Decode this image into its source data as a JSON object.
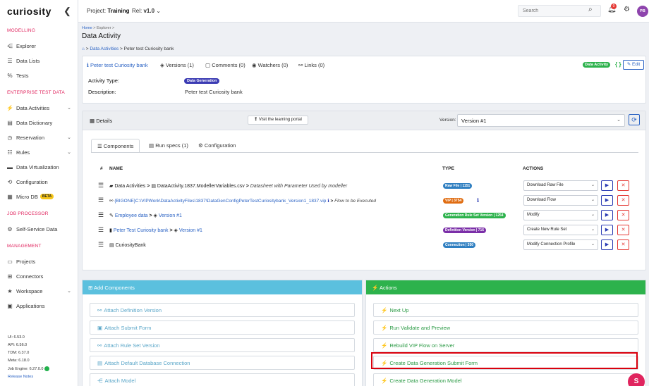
{
  "sidebar": {
    "logo": "curiosity",
    "collapse": "❮",
    "sections": [
      {
        "title": "MODELLING",
        "items": [
          {
            "label": "Explorer",
            "icon": "share-icon",
            "glyph": "⋲"
          },
          {
            "label": "Data Lists",
            "icon": "list-icon",
            "glyph": "☰"
          },
          {
            "label": "Tests",
            "icon": "percent-icon",
            "glyph": "%"
          }
        ]
      },
      {
        "title": "ENTERPRISE TEST DATA",
        "items": [
          {
            "label": "Data Activities",
            "icon": "bolt-icon",
            "glyph": "⚡",
            "chevron": "⌄"
          },
          {
            "label": "Data Dictionary",
            "icon": "book-icon",
            "glyph": "▤"
          },
          {
            "label": "Reservation",
            "icon": "clock-icon",
            "glyph": "◷",
            "chevron": "⌄"
          },
          {
            "label": "Rules",
            "icon": "rules-icon",
            "glyph": "☷",
            "chevron": "⌄"
          },
          {
            "label": "Data Virtualization",
            "icon": "virtualization-icon",
            "glyph": "▬"
          },
          {
            "label": "Configuration",
            "icon": "configuration-icon",
            "glyph": "⟲"
          },
          {
            "label": "Micro DB",
            "icon": "database-icon",
            "glyph": "▦",
            "badge": "BETA"
          }
        ]
      },
      {
        "title": "JOB PROCESSOR",
        "items": [
          {
            "label": "Self-Service Data",
            "icon": "gear-icon",
            "glyph": "⚙"
          }
        ]
      },
      {
        "title": "MANAGEMENT",
        "items": [
          {
            "label": "Projects",
            "icon": "folder-icon",
            "glyph": "▭"
          },
          {
            "label": "Connectors",
            "icon": "connectors-icon",
            "glyph": "⊞"
          },
          {
            "label": "Workspace",
            "icon": "star-icon",
            "glyph": "★",
            "chevron": "⌄"
          },
          {
            "label": "Applications",
            "icon": "applications-icon",
            "glyph": "▣"
          }
        ]
      }
    ],
    "versions": [
      "UI: 6.53.0",
      "API: 6.56.0",
      "TDM: 6.37.0",
      "Meta: 6.18.0",
      "Job Engine: 6.27.0.0"
    ],
    "release_notes": "Release Notes"
  },
  "topbar": {
    "project_label": "Project:",
    "project_value": "Training",
    "rel_label": "Rel:",
    "rel_value": "v1.0",
    "rel_chevron": "⌄",
    "search_placeholder": "Search",
    "notification_count": "0",
    "avatar_initials": "PB"
  },
  "breadcrumb": {
    "home": "Home",
    "sep": ">",
    "explorer": "Explorer",
    "page_title": "Data Activity",
    "trail_link": "Data Activities",
    "trail_current": "Peter test Curiosity bank"
  },
  "header": {
    "tabs": [
      {
        "label": "Peter test Curiosity bank",
        "icon": "info-icon",
        "glyph": "ℹ"
      },
      {
        "label": "Versions (1)",
        "icon": "layers-icon",
        "glyph": "◈"
      },
      {
        "label": "Comments (0)",
        "icon": "comment-icon",
        "glyph": "▢"
      },
      {
        "label": "Watchers (0)",
        "icon": "eye-icon",
        "glyph": "◉"
      },
      {
        "label": "Links (0)",
        "icon": "link-icon",
        "glyph": "⚯"
      }
    ],
    "status_badge": "Data Activity",
    "code_glyph": "{ }",
    "edit_label": "Edit",
    "activity_type_label": "Activity Type:",
    "activity_type_value": "Data Generation",
    "description_label": "Description:",
    "description_value": "Peter test Curiosity bank"
  },
  "details": {
    "title": "Details",
    "learning_portal": "Visit the learning portal",
    "version_label": "Version:",
    "version_value": "Version #1",
    "tabs": [
      {
        "label": "Components",
        "icon": "list-icon",
        "glyph": "☰"
      },
      {
        "label": "Run specs (1)",
        "icon": "runspecs-icon",
        "glyph": "▤"
      },
      {
        "label": "Configuration",
        "icon": "gear-icon",
        "glyph": "⚙"
      }
    ],
    "columns": {
      "hash": "#",
      "name": "NAME",
      "type": "TYPE",
      "actions": "ACTIONS"
    },
    "rows": [
      {
        "prefix": "Data Activities",
        "prefix_icon": "▰",
        "sep": ">",
        "file_icon": "▤",
        "link": "DataActivity.1837.ModellerVariables.csv",
        "suffix": "Datasheet with Parameter Used by modeller",
        "type": "Raw File | 1151",
        "type_color": "#2f7fc1",
        "action": "Download Raw File"
      },
      {
        "prefix": "",
        "prefix_icon": "⚯",
        "sep": "",
        "file_icon": "",
        "link": "{BIGONE}C:\\VIPWork\\DataActivityFiles\\1837\\DataGenConfigPeterTestCuriositybank_Version1_1837.vip",
        "suffix": "Flow to be Executed",
        "type": "VIP | 3754",
        "type_color": "#e06d12",
        "action": "Download Flow"
      },
      {
        "prefix": "",
        "prefix_icon": "✎",
        "sep": ">",
        "file_icon": "◈",
        "link": "Employee data",
        "link2": "Version #1",
        "suffix": "",
        "type": "Generation Rule Set Version | 1254",
        "type_color": "#2db24c",
        "action": "Modify"
      },
      {
        "prefix": "",
        "prefix_icon": "▮",
        "sep": ">",
        "file_icon": "◈",
        "link": "Peter Test Curiosity bank",
        "link2": "Version #1",
        "suffix": "",
        "type": "Definition Version | 716",
        "type_color": "#7b2fa8",
        "action": "Create New Rule Set"
      },
      {
        "prefix": "",
        "prefix_icon": "▤",
        "sep": "",
        "file_icon": "",
        "plain": "CuriosityBank",
        "suffix": "",
        "type": "Connection | 350",
        "type_color": "#2f7fc1",
        "action": "Modify Connection Profile"
      }
    ],
    "play_glyph": "▶",
    "delete_glyph": "✕",
    "select_chevron": "⌄"
  },
  "add_components": {
    "title": "Add Components",
    "items": [
      "Attach Definition Version",
      "Attach Submit Form",
      "Attach Rule Set Version",
      "Attach Default Database Connection",
      "Attach Model"
    ],
    "icons": [
      "link-icon",
      "image-icon",
      "link-icon",
      "database-icon",
      "share-icon"
    ],
    "glyphs": [
      "⚯",
      "▣",
      "⚯",
      "▤",
      "⋲"
    ]
  },
  "actions_panel": {
    "title": "Actions",
    "items": [
      "Next Up",
      "Run Validate and Preview",
      "Rebuild VIP Flow on Server",
      "Create Data Generation Submit Form",
      "Create Data Generation Model"
    ],
    "glyph": "⚡"
  },
  "chat_label": "S",
  "colors": {
    "accent": "#2b63c4",
    "brand_pink": "#e0245e",
    "success": "#2db24c",
    "info": "#5bc0de",
    "highlight": "#d9000d"
  }
}
